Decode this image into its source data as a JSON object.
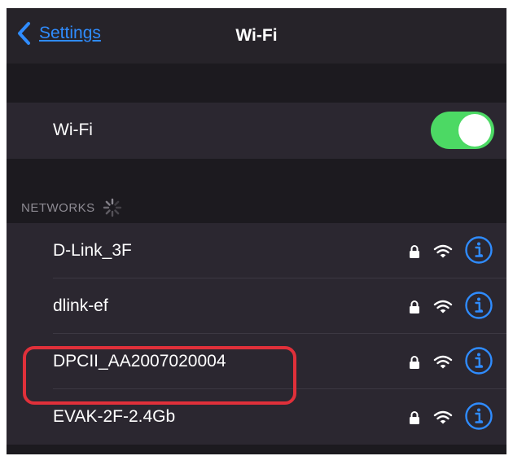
{
  "navbar": {
    "back_label": "Settings",
    "title": "Wi-Fi"
  },
  "wifi_toggle": {
    "label": "Wi-Fi",
    "enabled": true,
    "on_color": "#4cd964"
  },
  "networks_section": {
    "header": "NETWORKS",
    "scanning": true
  },
  "networks": [
    {
      "name": "D-Link_3F",
      "secured": true,
      "signal": "full"
    },
    {
      "name": "dlink-ef",
      "secured": true,
      "signal": "full"
    },
    {
      "name": "DPCII_AA2007020004",
      "secured": true,
      "signal": "full",
      "highlighted": true
    },
    {
      "name": "EVAK-2F-2.4Gb",
      "secured": true,
      "signal": "full"
    }
  ],
  "colors": {
    "accent": "#2f8cff",
    "highlight": "#e0303a",
    "background": "#1c1a1f",
    "cell": "#2b2730"
  }
}
